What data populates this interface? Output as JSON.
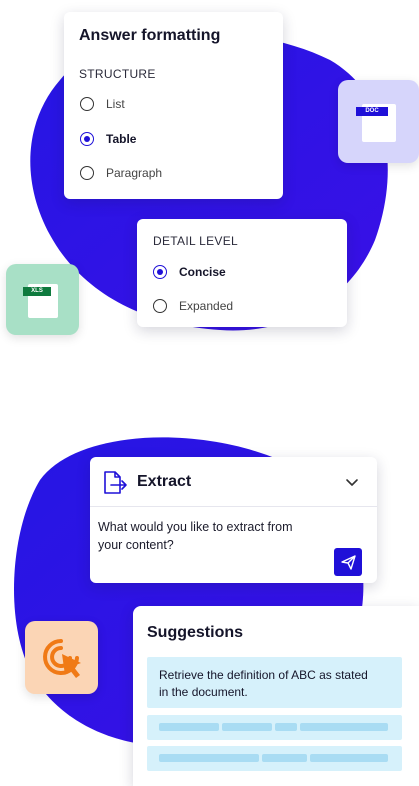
{
  "answer_formatting": {
    "title": "Answer formatting",
    "structure_label": "STRUCTURE",
    "options": [
      {
        "label": "List",
        "selected": false
      },
      {
        "label": "Table",
        "selected": true
      },
      {
        "label": "Paragraph",
        "selected": false
      }
    ]
  },
  "detail_level": {
    "label": "DETAIL LEVEL",
    "options": [
      {
        "label": "Concise",
        "selected": true
      },
      {
        "label": "Expanded",
        "selected": false
      }
    ]
  },
  "files": {
    "doc_tag": "DOC",
    "xls_tag": "XLS"
  },
  "extract": {
    "title": "Extract",
    "prompt_line1": "What would you like to extract from",
    "prompt_line2": "your content?"
  },
  "suggestions": {
    "title": "Suggestions",
    "first_line1": "Retrieve the definition of ABC as stated",
    "first_line2": "in the document."
  },
  "colors": {
    "accent": "#1f10d8",
    "blob": "#2e12e8",
    "doc_tile": "#d6d5fb",
    "xls_tile": "#a8e0c6",
    "cursor_tile": "#fbd5b5",
    "cursor_icon": "#f07a16",
    "suggestion_bg": "#d6f1fb"
  },
  "icons": {
    "extract": "document-export-icon",
    "send": "send-icon",
    "chevron": "chevron-down-icon",
    "cursor": "click-target-icon"
  }
}
